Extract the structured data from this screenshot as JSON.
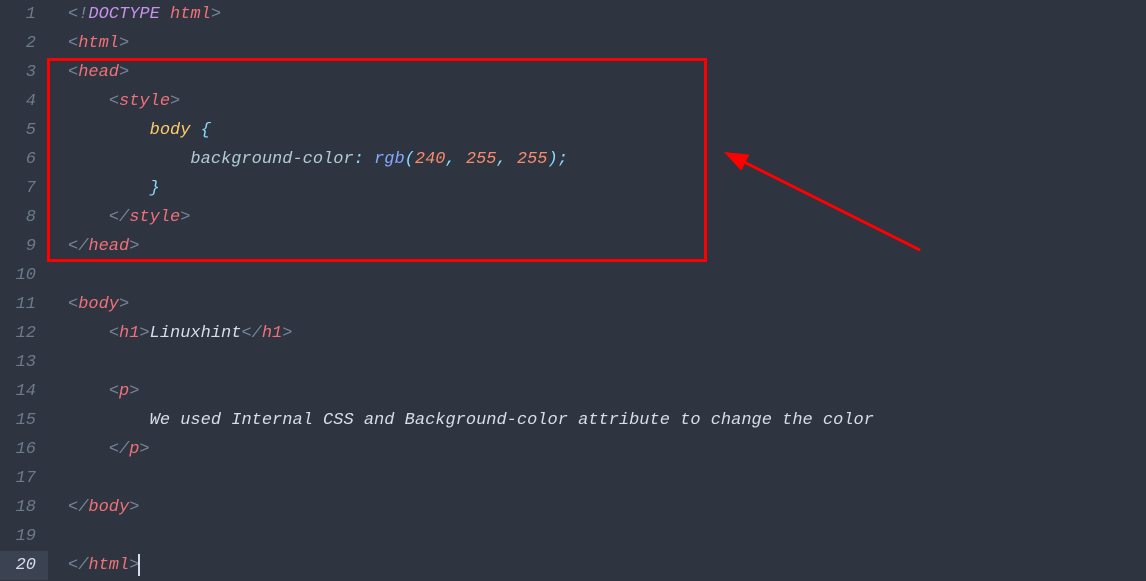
{
  "lineNumbers": [
    "1",
    "2",
    "3",
    "4",
    "5",
    "6",
    "7",
    "8",
    "9",
    "10",
    "11",
    "12",
    "13",
    "14",
    "15",
    "16",
    "17",
    "18",
    "19",
    "20"
  ],
  "currentLine": 20,
  "code": {
    "doctype_kw": "DOCTYPE",
    "doctype_val": "html",
    "tag_html": "html",
    "tag_head": "head",
    "tag_style": "style",
    "tag_body": "body",
    "tag_h1": "h1",
    "tag_p": "p",
    "css_selector": "body",
    "css_prop": "background-color",
    "css_func": "rgb",
    "css_val1": "240",
    "css_val2": "255",
    "css_val3": "255",
    "h1_text": "Linuxhint",
    "p_text": "We used Internal CSS and Background-color attribute to change the color"
  }
}
